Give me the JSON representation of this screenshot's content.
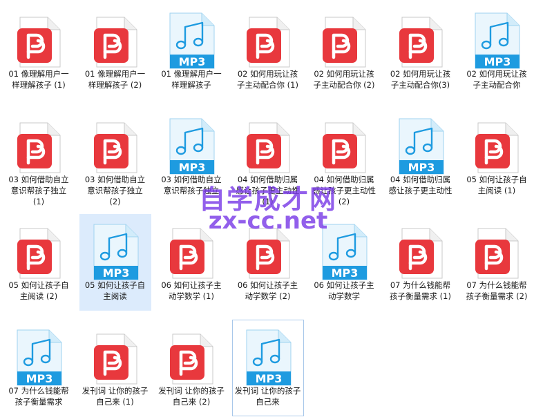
{
  "files": [
    {
      "type": "pdf",
      "name": "01 像理解用户一样理解孩子 (1)"
    },
    {
      "type": "pdf",
      "name": "01 像理解用户一样理解孩子 (2)"
    },
    {
      "type": "mp3",
      "name": "01 像理解用户一样理解孩子"
    },
    {
      "type": "pdf",
      "name": "02 如何用玩让孩子主动配合你 (1)"
    },
    {
      "type": "pdf",
      "name": "02 如何用玩让孩子主动配合你 (2)"
    },
    {
      "type": "pdf",
      "name": "02 如何用玩让孩子主动配合你(3)"
    },
    {
      "type": "mp3",
      "name": "02 如何用玩让孩子主动配合你"
    },
    {
      "type": "pdf",
      "name": "03 如何借助自立意识帮孩子独立 (1)"
    },
    {
      "type": "pdf",
      "name": "03 如何借助自立意识帮孩子独立 (2)"
    },
    {
      "type": "mp3",
      "name": "03 如何借助自立意识帮孩子独立"
    },
    {
      "type": "pdf",
      "name": "04 如何借助归属感让孩子更主动性 (1)"
    },
    {
      "type": "pdf",
      "name": "04 如何借助归属感让孩子更主动性 (2)"
    },
    {
      "type": "mp3",
      "name": "04 如何借助归属感让孩子更主动性"
    },
    {
      "type": "pdf",
      "name": "05 如何让孩子自主阅读 (1)"
    },
    {
      "type": "pdf",
      "name": "05 如何让孩子自主阅读 (2)"
    },
    {
      "type": "mp3",
      "name": "05 如何让孩子自主阅读",
      "selected": true
    },
    {
      "type": "pdf",
      "name": "06 如何让孩子主动学数学 (1)"
    },
    {
      "type": "pdf",
      "name": "06 如何让孩子主动学数学 (2)"
    },
    {
      "type": "mp3",
      "name": "06 如何让孩子主动学数学"
    },
    {
      "type": "pdf",
      "name": "07 为什么钱能帮孩子衡量需求 (1)"
    },
    {
      "type": "pdf",
      "name": "07 为什么钱能帮孩子衡量需求 (2)"
    },
    {
      "type": "mp3",
      "name": "07 为什么钱能帮孩子衡量需求"
    },
    {
      "type": "pdf",
      "name": "发刊词  让你的孩子自己来 (1)"
    },
    {
      "type": "pdf",
      "name": "发刊词  让你的孩子自己来 (2)"
    },
    {
      "type": "mp3",
      "name": "发刊词  让你的孩子自己来",
      "focused": true
    }
  ],
  "mp3_badge": "MP3",
  "watermark": {
    "line1": "自学成才网",
    "line2": "zx-cc.net"
  },
  "colors": {
    "pdf_red": "#e8383d",
    "mp3_blue": "#1e9be0",
    "selection": "#dcebfc",
    "watermark": "#7a3ce6"
  }
}
